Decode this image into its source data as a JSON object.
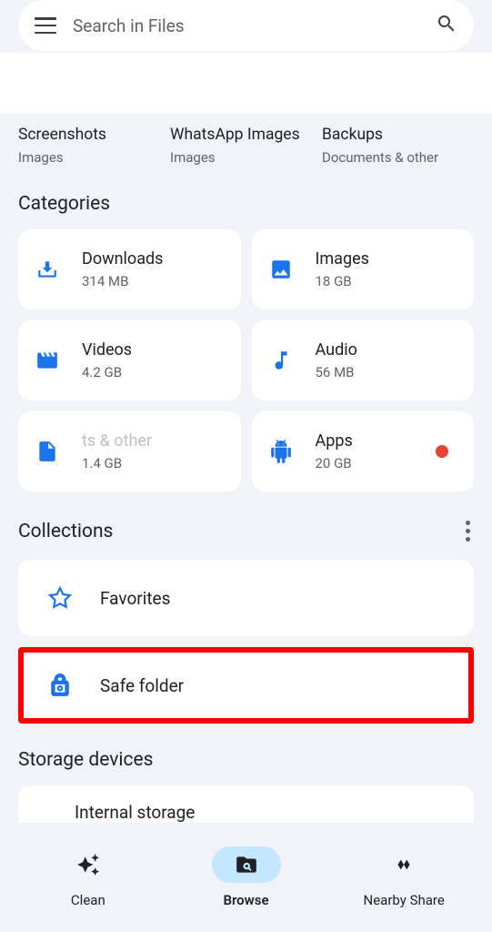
{
  "search": {
    "placeholder": "Search in Files"
  },
  "folders": [
    {
      "title": "Screenshots",
      "sub": "Images"
    },
    {
      "title": "WhatsApp Images",
      "sub": "Images"
    },
    {
      "title": "Backups",
      "sub": "Documents & other"
    }
  ],
  "sections": {
    "categories": "Categories",
    "collections": "Collections",
    "storage": "Storage devices"
  },
  "categories": [
    {
      "title": "Downloads",
      "sub": "314 MB",
      "icon": "download"
    },
    {
      "title": "Images",
      "sub": "18 GB",
      "icon": "image"
    },
    {
      "title": "Videos",
      "sub": "4.2 GB",
      "icon": "video"
    },
    {
      "title": "Audio",
      "sub": "56 MB",
      "icon": "audio"
    },
    {
      "title": "ts & other",
      "sub": "1.4 GB",
      "icon": "document"
    },
    {
      "title": "Apps",
      "sub": "20 GB",
      "icon": "apps",
      "dot": true
    }
  ],
  "collections": [
    {
      "title": "Favorites",
      "icon": "star"
    },
    {
      "title": "Safe folder",
      "icon": "lock"
    }
  ],
  "storage": {
    "item": "Internal storage"
  },
  "nav": [
    {
      "label": "Clean",
      "icon": "clean"
    },
    {
      "label": "Browse",
      "icon": "browse",
      "active": true
    },
    {
      "label": "Nearby Share",
      "icon": "share"
    }
  ]
}
